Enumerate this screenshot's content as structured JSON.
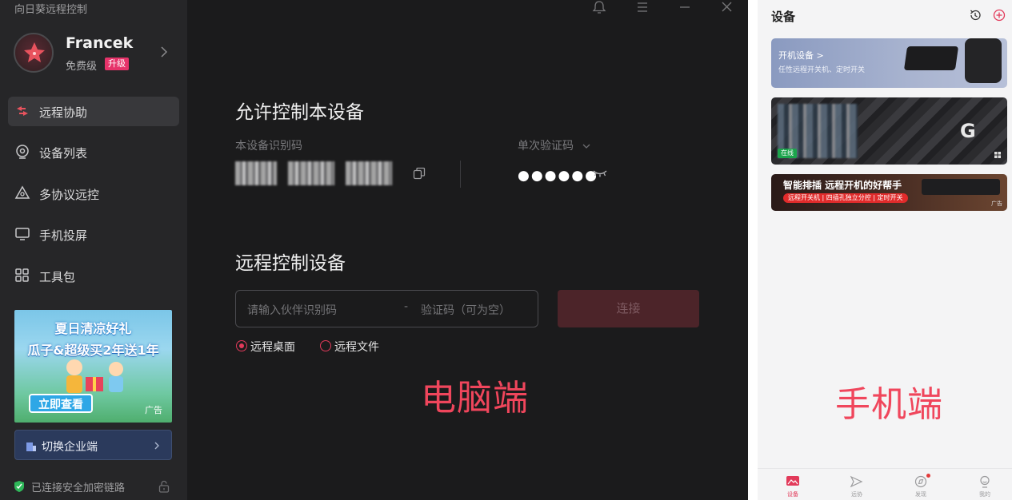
{
  "desktop": {
    "app_title": "向日葵远程控制",
    "user": {
      "name": "Francek",
      "tier": "免费级",
      "upgrade_label": "升级"
    },
    "nav": [
      {
        "label": "远程协助",
        "icon": "remote-assist-icon",
        "active": true
      },
      {
        "label": "设备列表",
        "icon": "device-list-icon",
        "active": false
      },
      {
        "label": "多协议远控",
        "icon": "multi-protocol-icon",
        "active": false
      },
      {
        "label": "手机投屏",
        "icon": "screen-cast-icon",
        "active": false
      },
      {
        "label": "工具包",
        "icon": "toolkit-icon",
        "active": false
      }
    ],
    "promo": {
      "line1": "夏日清凉好礼",
      "line2": "瓜子&超级买2年送1年",
      "cta": "立即查看",
      "ad_label": "广告"
    },
    "enterprise_button": "切换企业端",
    "secure_status": "已连接安全加密链路",
    "allow_section": {
      "title": "允许控制本设备",
      "device_id_label": "本设备识别码",
      "device_id_masked": [
        "271",
        "232",
        "172"
      ],
      "verify_label": "单次验证码",
      "verify_value": "●●●●●●"
    },
    "remote_section": {
      "title": "远程控制设备",
      "partner_placeholder": "请输入伙伴识别码",
      "separator": "-",
      "code_placeholder": "验证码（可为空）",
      "connect_label": "连接",
      "mode_options": [
        {
          "label": "远程桌面",
          "selected": true
        },
        {
          "label": "远程文件",
          "selected": false
        }
      ]
    },
    "overlay_label": "电脑端",
    "accent_color": "#e23a5a"
  },
  "phone": {
    "title": "设备",
    "card_power": {
      "title": "开机设备 >",
      "subtitle": "任性远程开关机、定时开关"
    },
    "card_device": {
      "online_label": "在线",
      "logo_text": "G"
    },
    "card_ad": {
      "title": "智能排插 远程开机的好帮手",
      "strip": "远程开关机 | 四插孔独立分控 | 定时开关",
      "ad_label": "广告"
    },
    "overlay_label": "手机端",
    "tabs": [
      {
        "label": "设备",
        "icon": "device-tab-icon",
        "active": true
      },
      {
        "label": "远协",
        "icon": "remote-tab-icon",
        "active": false
      },
      {
        "label": "发现",
        "icon": "discover-tab-icon",
        "active": false,
        "badge": true
      },
      {
        "label": "我的",
        "icon": "profile-tab-icon",
        "active": false
      }
    ]
  }
}
